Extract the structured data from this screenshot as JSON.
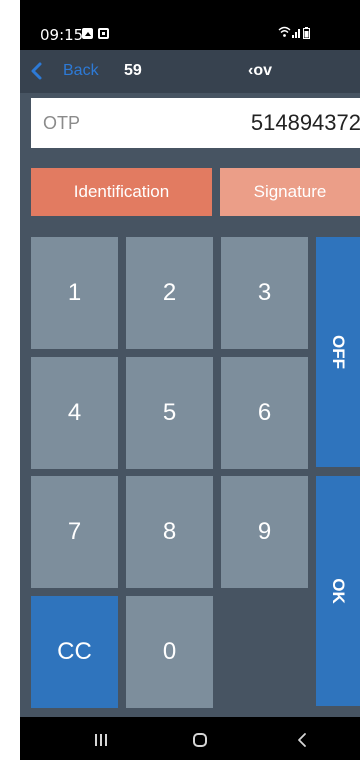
{
  "status_bar": {
    "time": "09:15"
  },
  "top_bar": {
    "back_label": "Back",
    "account": "59",
    "title": "‹ov"
  },
  "otp": {
    "label": "OTP",
    "value": "514894372"
  },
  "modes": {
    "identification": "Identification",
    "signature": "Signature"
  },
  "keypad": {
    "k1": "1",
    "k2": "2",
    "k3": "3",
    "k4": "4",
    "k5": "5",
    "k6": "6",
    "k7": "7",
    "k8": "8",
    "k9": "9",
    "kcc": "CC",
    "k0": "0"
  },
  "side_buttons": {
    "off": "OFF",
    "ok": "OK"
  },
  "colors": {
    "background": "#475462",
    "key": "#7d8e9c",
    "accent_blue": "#2f74bd",
    "identification": "#e27b61",
    "signature": "#eb9e88"
  }
}
